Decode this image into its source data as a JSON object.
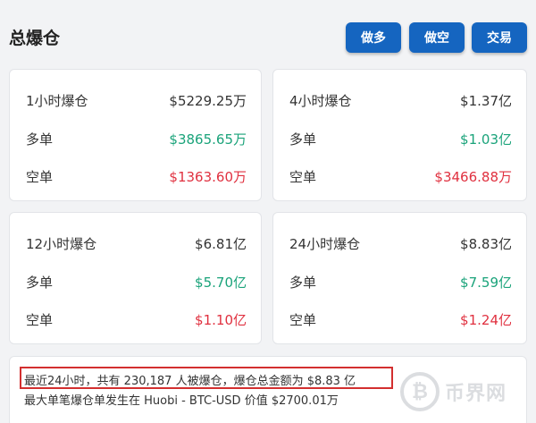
{
  "header": {
    "title": "总爆仓",
    "buttons": {
      "long": "做多",
      "short": "做空",
      "trade": "交易"
    }
  },
  "cards": [
    {
      "period": "1小时爆仓",
      "total": "$5229.25万",
      "long_label": "多单",
      "long": "$3865.65万",
      "short_label": "空单",
      "short": "$1363.60万"
    },
    {
      "period": "4小时爆仓",
      "total": "$1.37亿",
      "long_label": "多单",
      "long": "$1.03亿",
      "short_label": "空单",
      "short": "$3466.88万"
    },
    {
      "period": "12小时爆仓",
      "total": "$6.81亿",
      "long_label": "多单",
      "long": "$5.70亿",
      "short_label": "空单",
      "short": "$1.10亿"
    },
    {
      "period": "24小时爆仓",
      "total": "$8.83亿",
      "long_label": "多单",
      "long": "$7.59亿",
      "short_label": "空单",
      "short": "$1.24亿"
    }
  ],
  "summary": {
    "line1": "最近24小时，共有 230,187 人被爆仓，爆仓总金额为 $8.83 亿",
    "line2": "最大单笔爆仓单发生在 Huobi - BTC-USD 价值 $2700.01万"
  },
  "watermark": {
    "icon": "coin-b-icon",
    "text": "币界网"
  },
  "colors": {
    "accent": "#1565c0",
    "long": "#1aa37a",
    "short": "#e0303f",
    "highlight": "#d32f2f"
  }
}
